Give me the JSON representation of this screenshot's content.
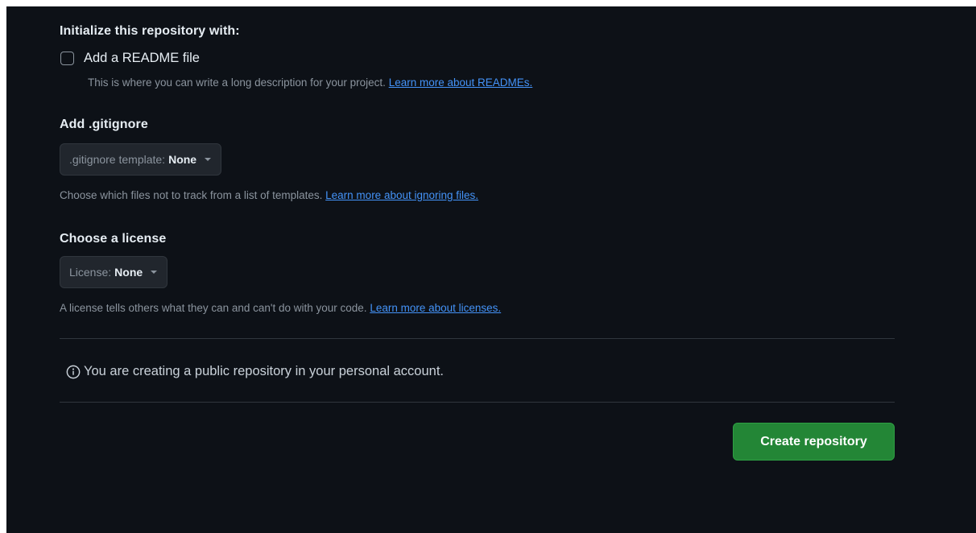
{
  "initialize": {
    "title": "Initialize this repository with:",
    "readme": {
      "label": "Add a README file",
      "checked": false,
      "help_text": "This is where you can write a long description for your project.",
      "link_text": "Learn more about READMEs."
    }
  },
  "gitignore": {
    "title": "Add .gitignore",
    "dropdown_prefix": ".gitignore template:",
    "dropdown_value": "None",
    "help_text": "Choose which files not to track from a list of templates.",
    "link_text": "Learn more about ignoring files."
  },
  "license": {
    "title": "Choose a license",
    "dropdown_prefix": "License:",
    "dropdown_value": "None",
    "help_text": "A license tells others what they can and can't do with your code.",
    "link_text": "Learn more about licenses."
  },
  "notice": {
    "icon": "info-icon",
    "text": "You are creating a public repository in your personal account."
  },
  "actions": {
    "create_label": "Create repository"
  },
  "colors": {
    "background": "#0d1117",
    "link": "#4493f8",
    "primary_button": "#238636"
  }
}
